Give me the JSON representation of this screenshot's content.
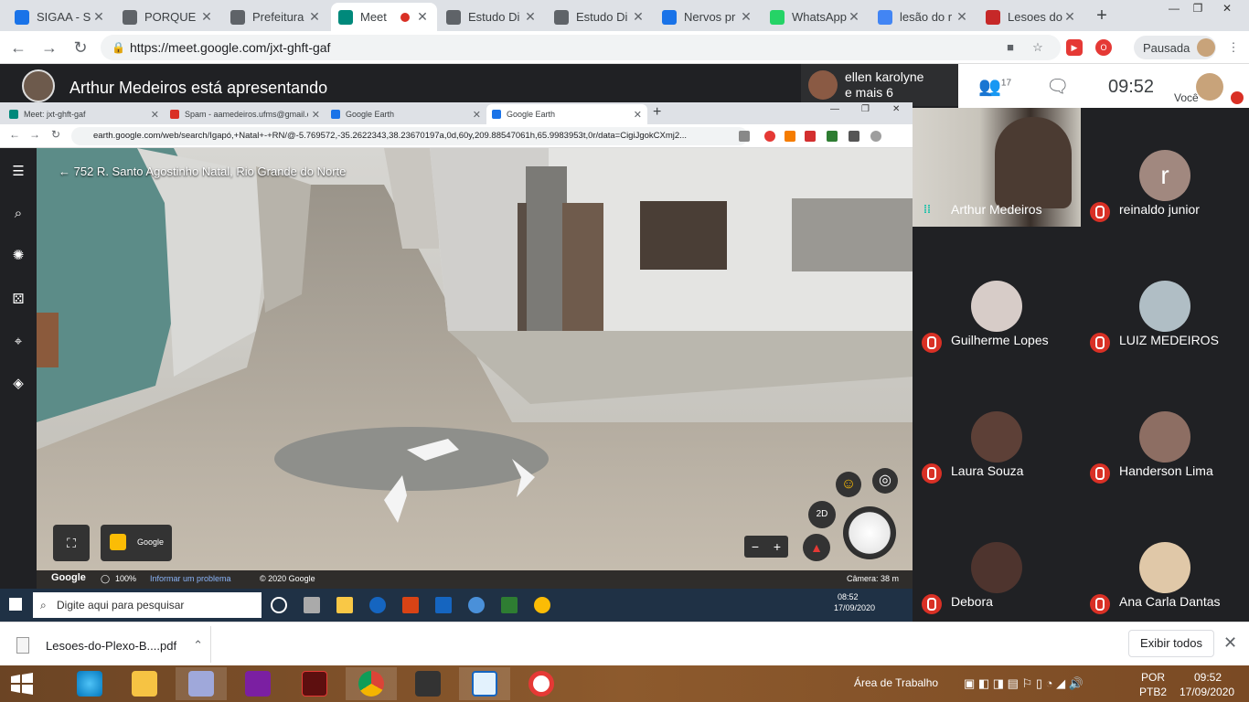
{
  "browser_tabs": [
    {
      "label": "SIGAA - Si",
      "color": "#1a73e8"
    },
    {
      "label": "PORQUE U",
      "color": "#5f6368"
    },
    {
      "label": "Prefeitura",
      "color": "#5f6368"
    },
    {
      "label": "Meet",
      "color": "#00897b",
      "active": true
    },
    {
      "label": "Estudo Di",
      "color": "#5f6368"
    },
    {
      "label": "Estudo Di",
      "color": "#5f6368"
    },
    {
      "label": "Nervos pr",
      "color": "#1a73e8"
    },
    {
      "label": "WhatsApp",
      "color": "#25d366"
    },
    {
      "label": "lesão do r",
      "color": "#4285f4"
    },
    {
      "label": "Lesoes do",
      "color": "#c62828"
    }
  ],
  "address": {
    "url": "https://meet.google.com/jxt-ghft-gaf"
  },
  "profile": {
    "label": "Pausada"
  },
  "meet": {
    "presenter_text": "Arthur Medeiros está apresentando",
    "ellen": {
      "line1": "ellen karolyne",
      "line2": "e mais 6"
    },
    "people_count": "17",
    "clock": "09:52",
    "you_label": "Você"
  },
  "shared": {
    "tabs": [
      {
        "label": "Meet: jxt-ghft-gaf",
        "color": "#00897b"
      },
      {
        "label": "Spam - aamedeiros.ufms@gmail.com",
        "color": "#d93025"
      },
      {
        "label": "Google Earth",
        "color": "#1a73e8"
      },
      {
        "label": "Google Earth",
        "color": "#1a73e8",
        "active": true
      }
    ],
    "url": "earth.google.com/web/search/Igapó,+Natal+-+RN/@-5.769572,-35.2622343,38.23670197a,0d,60y,209.88547061h,65.9983953t,0r/data=CigiJgokCXmj2...",
    "earth": {
      "place": "752 R. Santo Agostinho Natal, Rio Grande do Norte",
      "google": "Google",
      "zoom": "100%",
      "report": "Informar um problema",
      "copyright": "© 2020 Google",
      "camera": "Câmera: 38 m",
      "mode_2d": "2D",
      "thumb_label": "Google"
    },
    "taskbar": {
      "search_placeholder": "Digite aqui para pesquisar",
      "time": "08:52",
      "date": "17/09/2020"
    }
  },
  "participants": [
    {
      "name": "Arthur Medeiros",
      "speaking": true
    },
    {
      "name": "reinaldo junior",
      "initial": "r",
      "avatar_color": "#a1887f"
    },
    {
      "name": "Guilherme Lopes",
      "avatar_color": "#d7ccc8"
    },
    {
      "name": "LUIZ MEDEIROS",
      "avatar_color": "#b0bec5"
    },
    {
      "name": "Laura Souza",
      "avatar_color": "#5d4037"
    },
    {
      "name": "Handerson Lima",
      "avatar_color": "#8d6e63"
    },
    {
      "name": "Debora",
      "avatar_color": "#4e342e"
    },
    {
      "name": "Ana Carla Dantas",
      "avatar_color": "#e0c8a8"
    }
  ],
  "download": {
    "file": "Lesoes-do-Plexo-B....pdf",
    "show_all": "Exibir todos"
  },
  "os_taskbar": {
    "desktop_label": "Área de Trabalho",
    "lang1": "POR",
    "lang2": "PTB2",
    "time": "09:52",
    "date": "17/09/2020"
  }
}
